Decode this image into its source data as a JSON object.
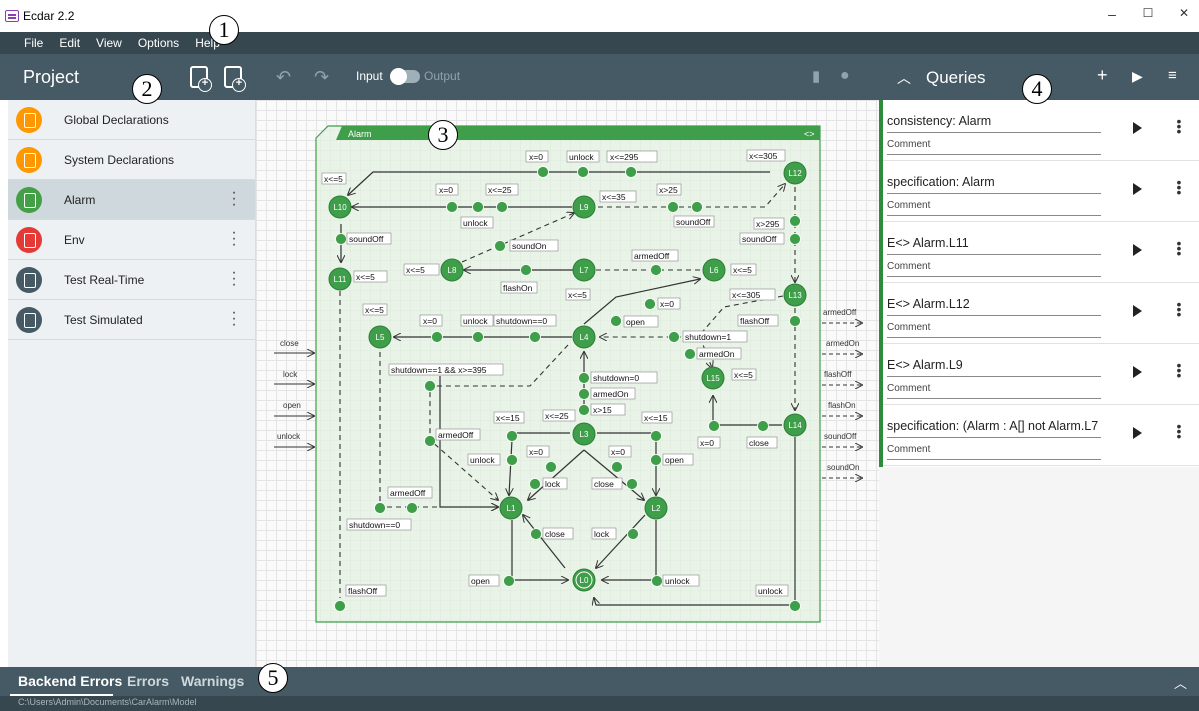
{
  "window": {
    "title": "Ecdar 2.2",
    "minimize": "–",
    "maximize": "☐",
    "close": "✕"
  },
  "menu": [
    "File",
    "Edit",
    "View",
    "Options",
    "Help"
  ],
  "callouts": [
    "1",
    "2",
    "3",
    "4",
    "5"
  ],
  "project": {
    "title": "Project",
    "items": [
      {
        "label": "Global Declarations",
        "color": "#ff9800"
      },
      {
        "label": "System Declarations",
        "color": "#ff9800"
      },
      {
        "label": "Alarm",
        "color": "#43a047"
      },
      {
        "label": "Env",
        "color": "#e53935"
      },
      {
        "label": "Test Real-Time",
        "color": "#455a64"
      },
      {
        "label": "Test Simulated",
        "color": "#455a64"
      }
    ]
  },
  "toolbar": {
    "input_label": "Input",
    "output_label": "Output"
  },
  "component": {
    "name": "Alarm",
    "locations": [
      "L0",
      "L1",
      "L2",
      "L3",
      "L4",
      "L5",
      "L6",
      "L7",
      "L8",
      "L9",
      "L10",
      "L11",
      "L12",
      "L13",
      "L14",
      "L15"
    ],
    "labels": {
      "x0a": "x=0",
      "unlock1": "unlock",
      "x295": "x<=295",
      "x305": "x<=305",
      "x5a": "x<=5",
      "x0b": "x=0",
      "x25a": "x<=25",
      "x35": "x<=35",
      "xgt25": "x>25",
      "unlock2": "unlock",
      "soundOff1": "soundOff",
      "xgt295": "x>295",
      "soundOff2": "soundOff",
      "soundOn": "soundOn",
      "armedOff1": "armedOff",
      "x5b": "x<=5",
      "x5c": "x<=5",
      "x5d": "x<=5",
      "flashOn": "flashOn",
      "x5e": "x<=5",
      "x305b": "x<=305",
      "x0c": "x=0",
      "x5f": "x<=5",
      "x0d": "x=0",
      "unlock3": "unlock",
      "sd0a": "shutdown==0",
      "open1": "open",
      "flashOff1": "flashOff",
      "sd1": "shutdown=1",
      "armedOn1": "armedOn",
      "sdcond": "shutdown==1 && x>=395",
      "sd0b": "shutdown=0",
      "armedOn2": "armedOn",
      "xgt15": "x>15",
      "x15a": "x<=15",
      "x25b": "x<=25",
      "x15b": "x<=15",
      "x5g": "x<=5",
      "armedOff2": "armedOff",
      "x0e": "x=0",
      "x0f": "x=0",
      "unlock4": "unlock",
      "open2": "open",
      "lock1": "lock",
      "close1": "close",
      "x0g": "x=0",
      "close2": "close",
      "armedOff3": "armedOff",
      "sd0c": "shutdown==0",
      "close3": "close",
      "lock2": "lock",
      "open3": "open",
      "unlock5": "unlock",
      "flashOff2": "flashOff",
      "unlock6": "unlock"
    },
    "inputs": [
      "close",
      "lock",
      "open",
      "unlock"
    ],
    "outputs": [
      "armedOff",
      "armedOn",
      "flashOff",
      "flashOn",
      "soundOff",
      "soundOn"
    ]
  },
  "queries": {
    "title": "Queries",
    "items": [
      {
        "query": "consistency: Alarm",
        "comment": "Comment"
      },
      {
        "query": "specification: Alarm",
        "comment": "Comment"
      },
      {
        "query": "E<> Alarm.L11",
        "comment": "Comment"
      },
      {
        "query": "E<> Alarm.L12",
        "comment": "Comment"
      },
      {
        "query": "E<> Alarm.L9",
        "comment": "Comment"
      },
      {
        "query": "specification: (Alarm : A[] not Alarm.L7",
        "comment": "Comment"
      }
    ]
  },
  "messages": {
    "tabs": [
      "Backend Errors",
      "Errors",
      "Warnings"
    ],
    "path": "C:\\Users\\Admin\\Documents\\CarAlarm\\Model"
  },
  "colors": {
    "accent": "#2e8b3a",
    "header": "#455a64",
    "menubar": "#37474f",
    "location": "#3f9e4a"
  }
}
